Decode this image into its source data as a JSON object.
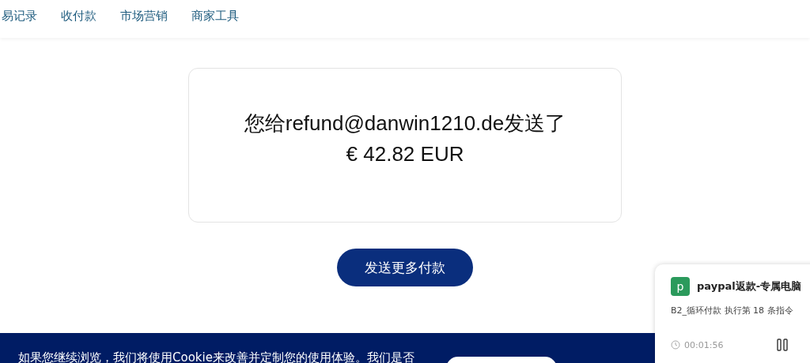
{
  "nav": {
    "items": [
      {
        "label": "易记录"
      },
      {
        "label": "收付款"
      },
      {
        "label": "市场营销"
      },
      {
        "label": "商家工具"
      }
    ]
  },
  "confirmation": {
    "message": "您给refund@danwin1210.de发送了",
    "amount": "€ 42.82 EUR"
  },
  "send_more_button": "发送更多付款",
  "cookie_banner": {
    "text": "如果您继续浏览，我们将使用Cookie来改善并定制您的使用体验。我们是否"
  },
  "task_panel": {
    "badge": "p",
    "title": "paypal返款-专属电脑",
    "status": "B2_循环付款 执行第 18 条指令",
    "elapsed": "00:01:56"
  }
}
